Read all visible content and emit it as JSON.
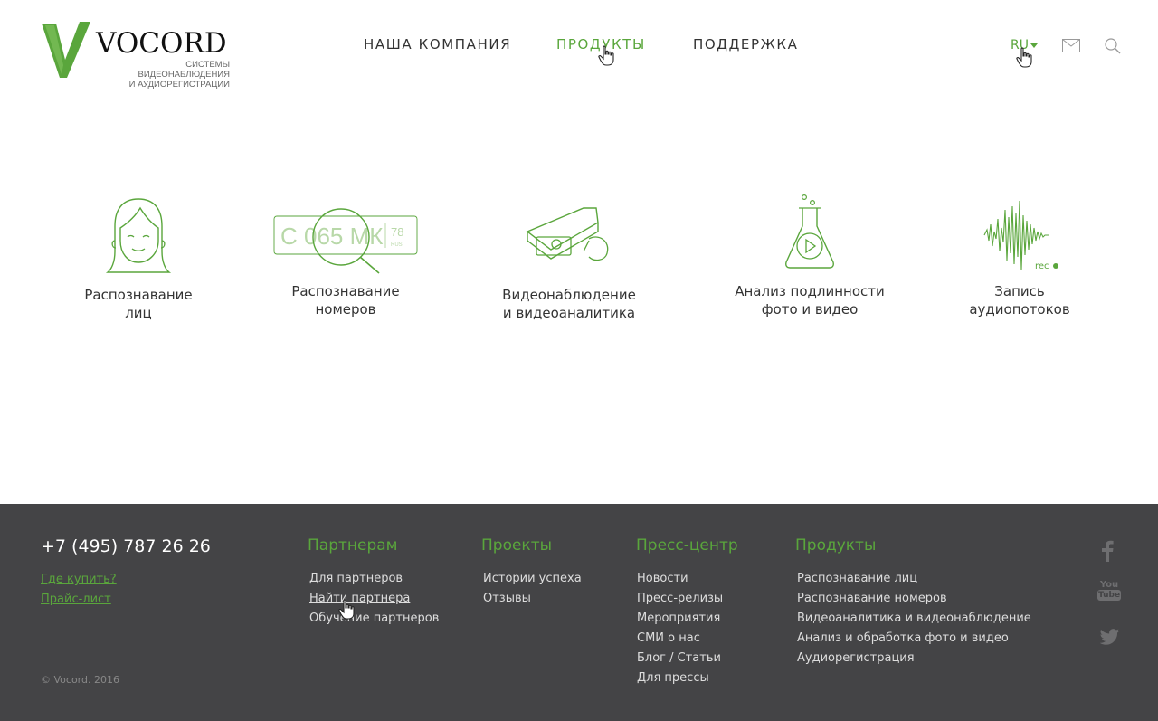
{
  "brand": {
    "name": "VOCORD",
    "subtitle_line1": "СИСТЕМЫ ВИДЕОНАБЛЮДЕНИЯ",
    "subtitle_line2": "И АУДИОРЕГИСТРАЦИИ",
    "accent_color": "#5aa63c"
  },
  "nav": {
    "items": [
      {
        "label": "НАША КОМПАНИЯ",
        "active": false
      },
      {
        "label": "ПРОДУКТЫ",
        "active": true
      },
      {
        "label": "ПОДДЕРЖКА",
        "active": false
      }
    ],
    "language": "RU",
    "icons": [
      "mail-icon",
      "search-icon"
    ]
  },
  "products": [
    {
      "line1": "Распознавание",
      "line2": "лиц",
      "icon": "face-icon"
    },
    {
      "line1": "Распознавание",
      "line2": "номеров",
      "icon": "license-plate-icon",
      "plate_text": "С 065 МК",
      "plate_region": "78",
      "plate_country": "RUS"
    },
    {
      "line1": "Видеонаблюдение",
      "line2": "и видеоаналитика",
      "icon": "camera-icon"
    },
    {
      "line1": "Анализ подлинности",
      "line2": "фото и видео",
      "icon": "flask-icon"
    },
    {
      "line1": "Запись",
      "line2": "аудиопотоков",
      "icon": "audio-wave-icon",
      "rec_label": "rec"
    }
  ],
  "footer": {
    "phone": "+7 (495) 787 26 26",
    "buy_link": "Где купить?",
    "price_link": "Прайс-лист",
    "copyright": "© Vocord. 2016",
    "columns": [
      {
        "title": "Партнерам",
        "items": [
          "Для партнеров",
          "Найти партнера",
          "Обучение партнеров"
        ]
      },
      {
        "title": "Проекты",
        "items": [
          "Истории успеха",
          "Отзывы"
        ]
      },
      {
        "title": "Пресс-центр",
        "items": [
          "Новости",
          "Пресс-релизы",
          "Мероприятия",
          "СМИ о нас",
          "Блог / Статьи",
          "Для прессы"
        ]
      },
      {
        "title": "Продукты",
        "items": [
          "Распознавание лиц",
          "Распознавание номеров",
          "Видеоаналитика и видеонаблюдение",
          "Анализ и обработка фото и видео",
          "Аудиорегистрация"
        ]
      }
    ],
    "social": [
      "facebook-icon",
      "youtube-icon",
      "twitter-icon"
    ],
    "youtube_text_top": "You",
    "youtube_text_bottom": "Tube",
    "footer_bg": "#444446"
  }
}
